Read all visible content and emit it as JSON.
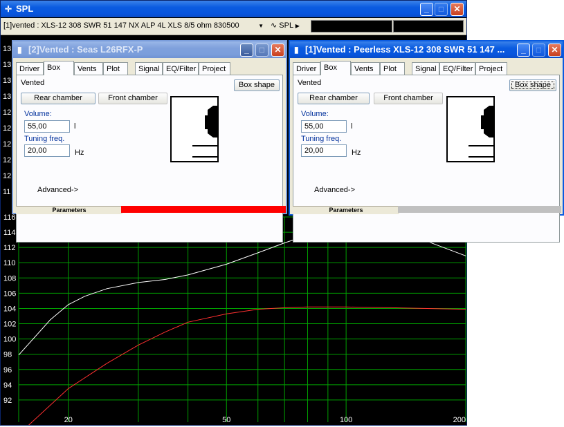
{
  "main_window": {
    "title": "SPL",
    "icon": "crosshair-icon",
    "selector_value": "[1]vented : XLS-12 308 SWR 51 147 NX ALP 4L XLS 8/5 ohm 830500",
    "spl_label": "SPL"
  },
  "hidden_y_labels": [
    "13",
    "13",
    "13",
    "13",
    "12",
    "12",
    "12",
    "12",
    "12",
    "11"
  ],
  "windows": [
    {
      "title": "[2]Vented : Seas  L26RFX-P",
      "tabs": [
        "Driver",
        "Box",
        "Vents",
        "Plot",
        "Signal",
        "EQ/Filter",
        "Project"
      ],
      "active_tab": "Box",
      "box_type": "Vented",
      "box_shape_label": "Box shape",
      "rear_chamber_label": "Rear chamber",
      "front_chamber_label": "Front chamber",
      "volume_label": "Volume:",
      "volume_value": "55,00",
      "volume_unit": "l",
      "tuning_label": "Tuning freq.",
      "tuning_value": "20,00",
      "tuning_unit": "Hz",
      "advanced_label": "Advanced->",
      "status_label": "Parameters",
      "status_color": "#ff0000"
    },
    {
      "title": "[1]Vented : Peerless XLS-12 308 SWR 51 147 ...",
      "tabs": [
        "Driver",
        "Box",
        "Vents",
        "Plot",
        "Signal",
        "EQ/Filter",
        "Project"
      ],
      "active_tab": "Box",
      "box_type": "Vented",
      "box_shape_label": "Box shape",
      "rear_chamber_label": "Rear chamber",
      "front_chamber_label": "Front chamber",
      "volume_label": "Volume:",
      "volume_value": "55,00",
      "volume_unit": "l",
      "tuning_label": "Tuning freq.",
      "tuning_value": "20,00",
      "tuning_unit": "Hz",
      "advanced_label": "Advanced->",
      "status_label": "Parameters",
      "status_color": "#c0c0c0"
    }
  ],
  "chart_data": {
    "type": "line",
    "x_scale": "log",
    "xlim": [
      15,
      200
    ],
    "ylim": [
      90,
      116
    ],
    "x_ticks": [
      20,
      50,
      100,
      200
    ],
    "y_ticks": [
      92,
      94,
      96,
      98,
      100,
      102,
      104,
      106,
      108,
      110,
      112,
      114,
      116
    ],
    "grid": true,
    "series": [
      {
        "color": "#ffffff",
        "x": [
          15,
          18,
          20,
          22,
          25,
          30,
          35,
          40,
          50,
          60,
          70,
          80,
          90,
          100,
          110,
          130,
          160,
          200
        ],
        "y": [
          97.9,
          102.5,
          104.5,
          105.6,
          106.6,
          107.4,
          107.8,
          108.4,
          109.8,
          111.3,
          112.6,
          113.6,
          114.2,
          114.5,
          114.5,
          114.0,
          112.8,
          110.9
        ]
      },
      {
        "color": "#ff3030",
        "x": [
          15,
          20,
          25,
          30,
          35,
          40,
          50,
          60,
          70,
          80,
          100,
          130,
          160,
          200
        ],
        "y": [
          87.5,
          93.5,
          96.8,
          99.2,
          100.9,
          102.2,
          103.3,
          103.9,
          104.1,
          104.2,
          104.2,
          104.1,
          104.0,
          103.9
        ]
      }
    ]
  }
}
